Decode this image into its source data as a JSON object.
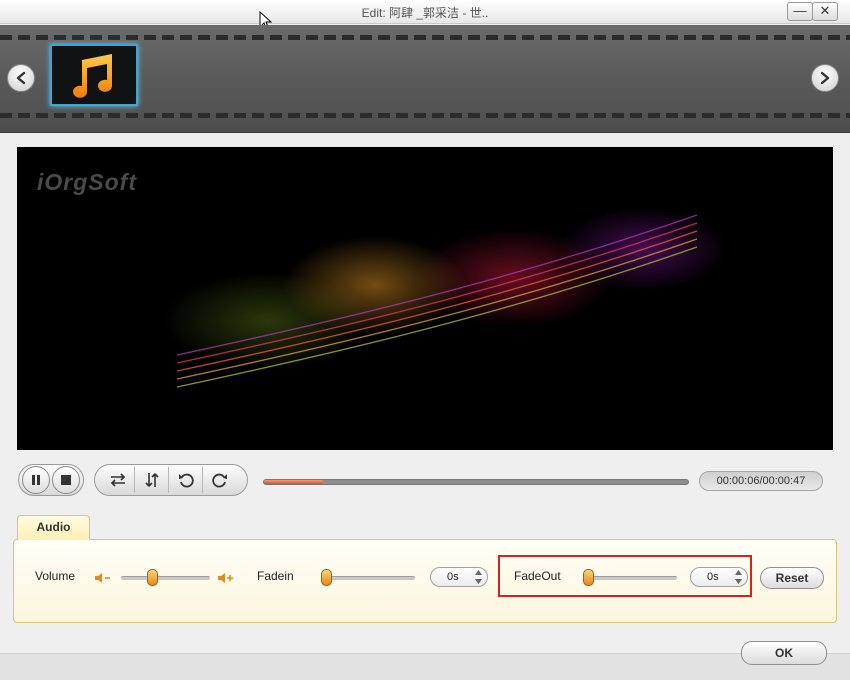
{
  "window": {
    "title": "Edit: 阿肆 _郭采洁 - 世..",
    "minimize_label": "—",
    "close_label": "✕"
  },
  "filmstrip": {
    "thumbnail_icon": "music-note-icon",
    "prev_icon": "chevron-left-icon",
    "next_icon": "chevron-right-icon"
  },
  "video": {
    "watermark": "iOrgSoft"
  },
  "playback": {
    "progress_fraction": 0.14,
    "time": "00:00:06/00:00:47"
  },
  "audio": {
    "tab_label": "Audio",
    "volume_label": "Volume",
    "volume_level": 0.33,
    "fadein_label": "Fadein",
    "fadein_level": 0.0,
    "fadein_value": "0s",
    "fadeout_label": "FadeOut",
    "fadeout_level": 0.0,
    "fadeout_value": "0s",
    "reset_label": "Reset"
  },
  "footer": {
    "ok_label": "OK"
  },
  "colors": {
    "accent_orange": "#e48a1a",
    "thumb_border": "#3aa7d6",
    "highlight_red": "#d8201f"
  }
}
